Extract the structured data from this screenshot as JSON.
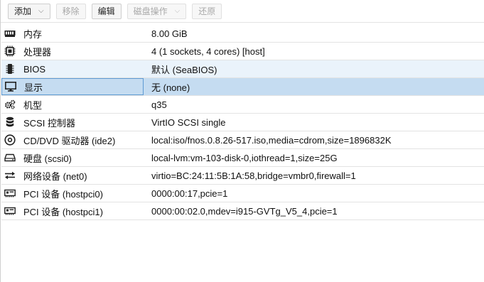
{
  "toolbar": {
    "add": "添加",
    "remove": "移除",
    "edit": "编辑",
    "disk_action": "磁盘操作",
    "revert": "还原"
  },
  "rows": [
    {
      "icon": "memory-icon",
      "key": "内存",
      "value": "8.00 GiB"
    },
    {
      "icon": "cpu-icon",
      "key": "处理器",
      "value": "4 (1 sockets, 4 cores) [host]"
    },
    {
      "icon": "chip-icon",
      "key": "BIOS",
      "value": "默认 (SeaBIOS)"
    },
    {
      "icon": "monitor-icon",
      "key": "显示",
      "value": "无 (none)"
    },
    {
      "icon": "gears-icon",
      "key": "机型",
      "value": "q35"
    },
    {
      "icon": "database-icon",
      "key": "SCSI 控制器",
      "value": "VirtIO SCSI single"
    },
    {
      "icon": "optical-disc-icon",
      "key": "CD/DVD 驱动器 (ide2)",
      "value": "local:iso/fnos.0.8.26-517.iso,media=cdrom,size=1896832K"
    },
    {
      "icon": "hard-disk-icon",
      "key": "硬盘 (scsi0)",
      "value": "local-lvm:vm-103-disk-0,iothread=1,size=25G"
    },
    {
      "icon": "network-exchange-icon",
      "key": "网络设备 (net0)",
      "value": "virtio=BC:24:11:5B:1A:58,bridge=vmbr0,firewall=1"
    },
    {
      "icon": "pci-card-icon",
      "key": "PCI 设备 (hostpci0)",
      "value": "0000:00:17,pcie=1"
    },
    {
      "icon": "pci-card-icon",
      "key": "PCI 设备 (hostpci1)",
      "value": "0000:00:02.0,mdev=i915-GVTg_V5_4,pcie=1"
    }
  ]
}
